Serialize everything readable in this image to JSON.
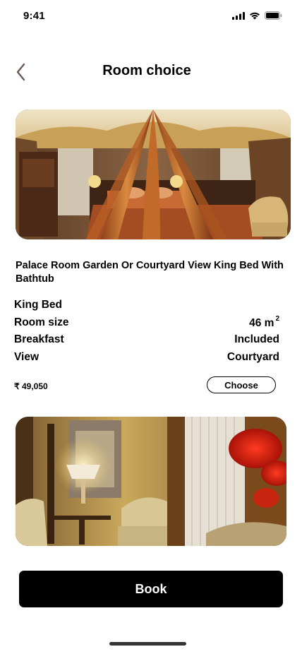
{
  "status": {
    "time": "9:41"
  },
  "header": {
    "title": "Room choice"
  },
  "room": {
    "name": "Palace Room Garden Or Courtyard View King Bed With Bathtub",
    "specs": {
      "bed_label": "King Bed",
      "size_label": "Room size",
      "size_value": "46 m",
      "size_unit_sup": "2",
      "breakfast_label": "Breakfast",
      "breakfast_value": "Included",
      "view_label": "View",
      "view_value": "Courtyard"
    },
    "price": "₹ 49,050",
    "choose_label": "Choose"
  },
  "book_label": "Book",
  "icons": [
    "signal-icon",
    "wifi-icon",
    "battery-icon",
    "back-chevron-icon"
  ]
}
